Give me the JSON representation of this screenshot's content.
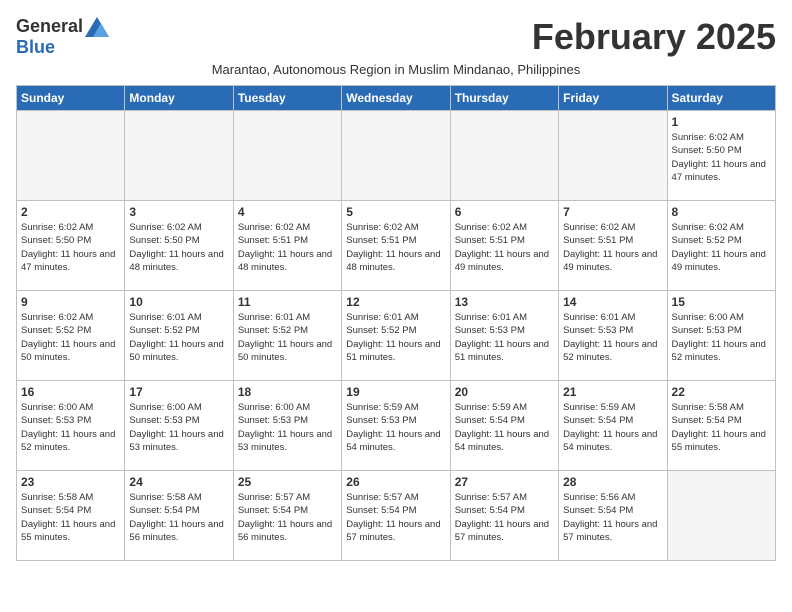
{
  "logo": {
    "general": "General",
    "blue": "Blue"
  },
  "title": "February 2025",
  "subtitle": "Marantao, Autonomous Region in Muslim Mindanao, Philippines",
  "headers": [
    "Sunday",
    "Monday",
    "Tuesday",
    "Wednesday",
    "Thursday",
    "Friday",
    "Saturday"
  ],
  "weeks": [
    [
      {
        "day": "",
        "info": ""
      },
      {
        "day": "",
        "info": ""
      },
      {
        "day": "",
        "info": ""
      },
      {
        "day": "",
        "info": ""
      },
      {
        "day": "",
        "info": ""
      },
      {
        "day": "",
        "info": ""
      },
      {
        "day": "1",
        "info": "Sunrise: 6:02 AM\nSunset: 5:50 PM\nDaylight: 11 hours and 47 minutes."
      }
    ],
    [
      {
        "day": "2",
        "info": "Sunrise: 6:02 AM\nSunset: 5:50 PM\nDaylight: 11 hours and 47 minutes."
      },
      {
        "day": "3",
        "info": "Sunrise: 6:02 AM\nSunset: 5:50 PM\nDaylight: 11 hours and 48 minutes."
      },
      {
        "day": "4",
        "info": "Sunrise: 6:02 AM\nSunset: 5:51 PM\nDaylight: 11 hours and 48 minutes."
      },
      {
        "day": "5",
        "info": "Sunrise: 6:02 AM\nSunset: 5:51 PM\nDaylight: 11 hours and 48 minutes."
      },
      {
        "day": "6",
        "info": "Sunrise: 6:02 AM\nSunset: 5:51 PM\nDaylight: 11 hours and 49 minutes."
      },
      {
        "day": "7",
        "info": "Sunrise: 6:02 AM\nSunset: 5:51 PM\nDaylight: 11 hours and 49 minutes."
      },
      {
        "day": "8",
        "info": "Sunrise: 6:02 AM\nSunset: 5:52 PM\nDaylight: 11 hours and 49 minutes."
      }
    ],
    [
      {
        "day": "9",
        "info": "Sunrise: 6:02 AM\nSunset: 5:52 PM\nDaylight: 11 hours and 50 minutes."
      },
      {
        "day": "10",
        "info": "Sunrise: 6:01 AM\nSunset: 5:52 PM\nDaylight: 11 hours and 50 minutes."
      },
      {
        "day": "11",
        "info": "Sunrise: 6:01 AM\nSunset: 5:52 PM\nDaylight: 11 hours and 50 minutes."
      },
      {
        "day": "12",
        "info": "Sunrise: 6:01 AM\nSunset: 5:52 PM\nDaylight: 11 hours and 51 minutes."
      },
      {
        "day": "13",
        "info": "Sunrise: 6:01 AM\nSunset: 5:53 PM\nDaylight: 11 hours and 51 minutes."
      },
      {
        "day": "14",
        "info": "Sunrise: 6:01 AM\nSunset: 5:53 PM\nDaylight: 11 hours and 52 minutes."
      },
      {
        "day": "15",
        "info": "Sunrise: 6:00 AM\nSunset: 5:53 PM\nDaylight: 11 hours and 52 minutes."
      }
    ],
    [
      {
        "day": "16",
        "info": "Sunrise: 6:00 AM\nSunset: 5:53 PM\nDaylight: 11 hours and 52 minutes."
      },
      {
        "day": "17",
        "info": "Sunrise: 6:00 AM\nSunset: 5:53 PM\nDaylight: 11 hours and 53 minutes."
      },
      {
        "day": "18",
        "info": "Sunrise: 6:00 AM\nSunset: 5:53 PM\nDaylight: 11 hours and 53 minutes."
      },
      {
        "day": "19",
        "info": "Sunrise: 5:59 AM\nSunset: 5:53 PM\nDaylight: 11 hours and 54 minutes."
      },
      {
        "day": "20",
        "info": "Sunrise: 5:59 AM\nSunset: 5:54 PM\nDaylight: 11 hours and 54 minutes."
      },
      {
        "day": "21",
        "info": "Sunrise: 5:59 AM\nSunset: 5:54 PM\nDaylight: 11 hours and 54 minutes."
      },
      {
        "day": "22",
        "info": "Sunrise: 5:58 AM\nSunset: 5:54 PM\nDaylight: 11 hours and 55 minutes."
      }
    ],
    [
      {
        "day": "23",
        "info": "Sunrise: 5:58 AM\nSunset: 5:54 PM\nDaylight: 11 hours and 55 minutes."
      },
      {
        "day": "24",
        "info": "Sunrise: 5:58 AM\nSunset: 5:54 PM\nDaylight: 11 hours and 56 minutes."
      },
      {
        "day": "25",
        "info": "Sunrise: 5:57 AM\nSunset: 5:54 PM\nDaylight: 11 hours and 56 minutes."
      },
      {
        "day": "26",
        "info": "Sunrise: 5:57 AM\nSunset: 5:54 PM\nDaylight: 11 hours and 57 minutes."
      },
      {
        "day": "27",
        "info": "Sunrise: 5:57 AM\nSunset: 5:54 PM\nDaylight: 11 hours and 57 minutes."
      },
      {
        "day": "28",
        "info": "Sunrise: 5:56 AM\nSunset: 5:54 PM\nDaylight: 11 hours and 57 minutes."
      },
      {
        "day": "",
        "info": ""
      }
    ]
  ]
}
